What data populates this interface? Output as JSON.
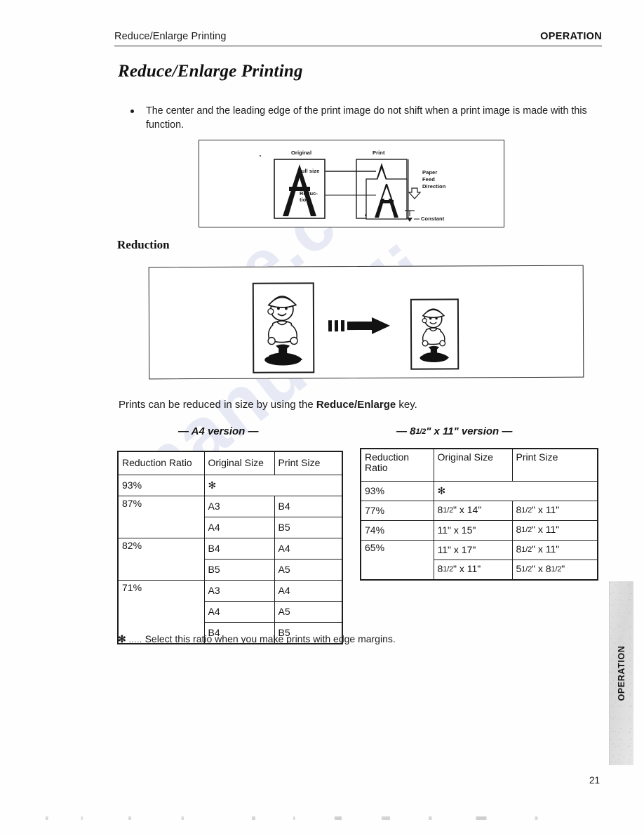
{
  "header": {
    "left_title": "Reduce/Enlarge Printing",
    "right_title": "OPERATION"
  },
  "main_title": "Reduce/Enlarge Printing",
  "bullet": {
    "text": "The center and the leading edge of the print image do not shift when a print image is made with this function."
  },
  "figure_one": {
    "labels": {
      "original": "Original",
      "print": "Print",
      "full_size": "Full size",
      "reduction_1": "Reduc-",
      "reduction_2": "tion",
      "paper_1": "Paper",
      "paper_2": "Feed",
      "paper_3": "Direction",
      "constant": "Constant"
    }
  },
  "sub_heading": "Reduction",
  "intro": {
    "before": "Prints can be reduced in size by using the ",
    "bold": "Reduce/Enlarge",
    "after": " key."
  },
  "tables": {
    "a4": {
      "caption": "— A4 version —",
      "columns": [
        "Reduction Ratio",
        "Original Size",
        "Print Size"
      ],
      "rows": [
        {
          "ratio": "93%",
          "original": "✻",
          "print": "",
          "is_note_row": true
        },
        {
          "ratio": "87%",
          "original": "A3",
          "print": "B4"
        },
        {
          "ratio": "",
          "original": "A4",
          "print": "B5"
        },
        {
          "ratio": "82%",
          "original": "B4",
          "print": "A4"
        },
        {
          "ratio": "",
          "original": "B5",
          "print": "A5"
        },
        {
          "ratio": "71%",
          "original": "A3",
          "print": "A4"
        },
        {
          "ratio": "",
          "original": "A4",
          "print": "A5"
        },
        {
          "ratio": "",
          "original": "B4",
          "print": "B5"
        }
      ]
    },
    "letter": {
      "caption": "— 81/2\" x 11\" version —",
      "columns": [
        "Reduction Ratio",
        "Original Size",
        "Print Size"
      ],
      "rows": [
        {
          "ratio": "93%",
          "original": "✻",
          "print": "",
          "is_note_row": true
        },
        {
          "ratio": "77%",
          "original": "81/2\" x 14\"",
          "print": "81/2\" x 11\""
        },
        {
          "ratio": "74%",
          "original": "11\" x 15\"",
          "print": "81/2\" x 11\""
        },
        {
          "ratio": "65%",
          "original": "11\" x 17\"",
          "print": "81/2\" x 11\""
        },
        {
          "ratio": "",
          "original": "81/2\" x 11\"",
          "print": "51/2\" x 81/2\""
        }
      ]
    }
  },
  "footnote": {
    "mark": "✻",
    "dots": " ..... ",
    "text": "Select this ratio when you make prints with edge margins."
  },
  "side_tab": {
    "label": "OPERATION"
  },
  "page_number": "21",
  "watermark": {
    "line1": "manualsli",
    "line2": "ve.com"
  }
}
